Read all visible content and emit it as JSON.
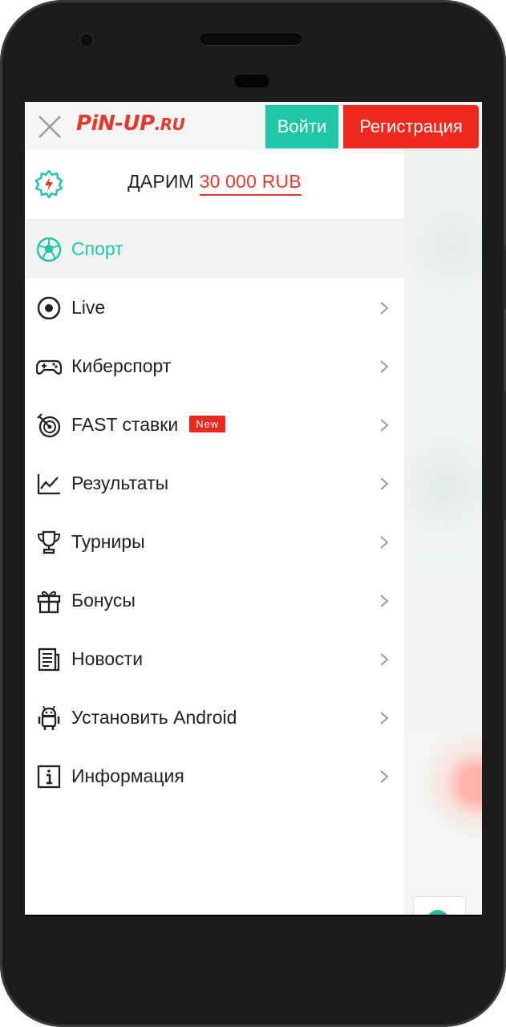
{
  "header": {
    "logo_main": "PiN-UP",
    "logo_tld": ".RU",
    "login_label": "Войти",
    "register_label": "Регистрация"
  },
  "promo": {
    "text": "ДАРИМ",
    "amount": "30 000 RUB"
  },
  "menu": {
    "items": [
      {
        "label": "Спорт",
        "icon": "soccer-ball-icon",
        "active": true
      },
      {
        "label": "Live",
        "icon": "live-circle-icon"
      },
      {
        "label": "Киберспорт",
        "icon": "gamepad-icon"
      },
      {
        "label": "FAST ставки",
        "icon": "target-icon",
        "badge": "New"
      },
      {
        "label": "Результаты",
        "icon": "chart-line-icon"
      },
      {
        "label": "Турниры",
        "icon": "trophy-icon"
      },
      {
        "label": "Бонусы",
        "icon": "gift-icon"
      },
      {
        "label": "Новости",
        "icon": "newspaper-icon"
      },
      {
        "label": "Установить Android",
        "icon": "android-icon"
      },
      {
        "label": "Информация",
        "icon": "info-icon"
      }
    ]
  },
  "colors": {
    "brand_red": "#e53a2b",
    "accent_teal": "#1fc7a6",
    "register_red": "#f0281e"
  }
}
